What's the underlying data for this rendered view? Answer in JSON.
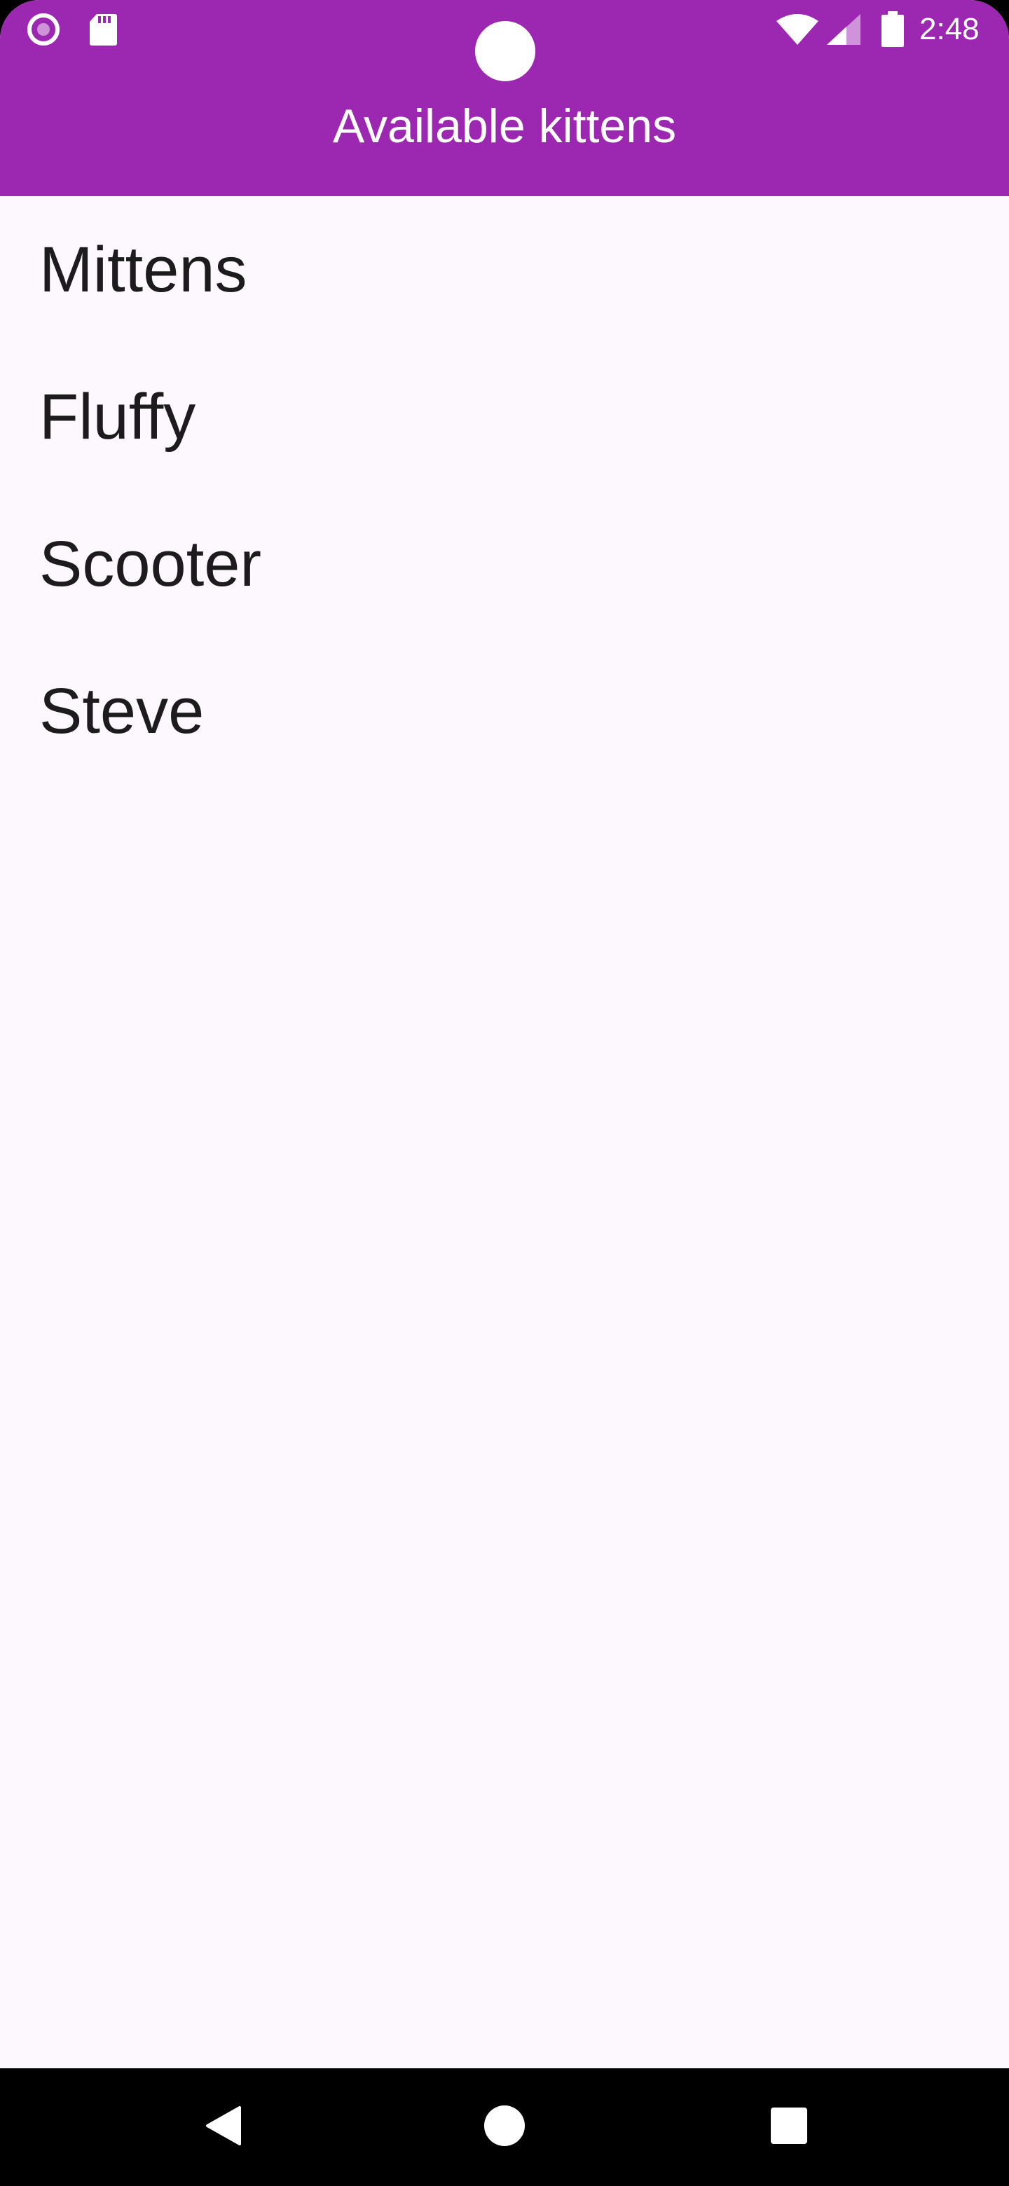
{
  "status_bar": {
    "time": "2:48",
    "icons": [
      "record-icon",
      "sd-card-icon",
      "wifi-icon",
      "cell-signal-icon",
      "battery-icon"
    ]
  },
  "app_bar": {
    "title": "Available kittens",
    "color": "#9c27b0"
  },
  "kittens": [
    {
      "name": "Mittens"
    },
    {
      "name": "Fluffy"
    },
    {
      "name": "Scooter"
    },
    {
      "name": "Steve"
    }
  ],
  "nav_bar": {
    "icons": [
      "back-icon",
      "home-icon",
      "recents-icon"
    ]
  },
  "colors": {
    "accent": "#9c27b0",
    "background": "#fdf8fd",
    "text": "#1d1b1e",
    "navbar": "#000000"
  }
}
